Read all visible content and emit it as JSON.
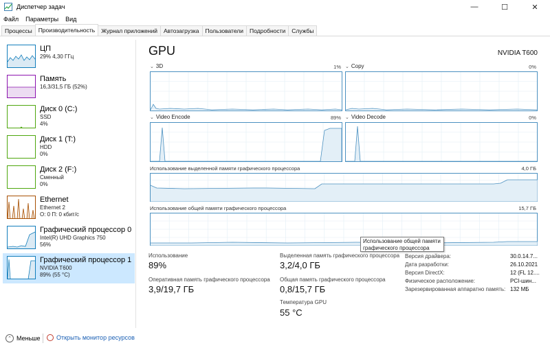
{
  "window": {
    "title": "Диспетчер задач",
    "minimize": "—",
    "maximize": "☐",
    "close": "✕"
  },
  "menu": [
    "Файл",
    "Параметры",
    "Вид"
  ],
  "tabs": [
    "Процессы",
    "Производительность",
    "Журнал приложений",
    "Автозагрузка",
    "Пользователи",
    "Подробности",
    "Службы"
  ],
  "active_tab": "Производительность",
  "sidebar": {
    "items": [
      {
        "name": "ЦП",
        "line1": "29% 4,30 ГГц",
        "line2": "",
        "color": "#117dbb"
      },
      {
        "name": "Память",
        "line1": "16,3/31,5 ГБ (52%)",
        "line2": "",
        "color": "#8b12ae"
      },
      {
        "name": "Диск 0 (C:)",
        "line1": "SSD",
        "line2": "4%",
        "color": "#4da60c"
      },
      {
        "name": "Диск 1 (T:)",
        "line1": "HDD",
        "line2": "0%",
        "color": "#4da60c"
      },
      {
        "name": "Диск 2 (F:)",
        "line1": "Сменный",
        "line2": "0%",
        "color": "#4da60c"
      },
      {
        "name": "Ethernet",
        "line1": "Ethernet 2",
        "line2": "О: 0 П: 0 кбит/с",
        "color": "#a74f01"
      },
      {
        "name": "Графический процессор 0",
        "line1": "Intel(R) UHD Graphics 750",
        "line2": "56%",
        "color": "#117dbb"
      },
      {
        "name": "Графический процессор 1",
        "line1": "NVIDIA T600",
        "line2": "89% (55 °C)",
        "color": "#117dbb"
      }
    ]
  },
  "main": {
    "title": "GPU",
    "model": "NVIDIA T600",
    "engines": [
      {
        "label": "3D",
        "percent": "1%"
      },
      {
        "label": "Copy",
        "percent": "0%"
      },
      {
        "label": "Video Encode",
        "percent": "89%"
      },
      {
        "label": "Video Decode",
        "percent": "0%"
      }
    ],
    "dedicated_memory": {
      "label": "Использование выделенной памяти графического процессора",
      "max": "4,0 ГБ"
    },
    "shared_memory": {
      "label": "Использование общей памяти графического процессора",
      "max": "15,7 ГБ"
    },
    "tooltip": "Использование общей памяти графического процессора",
    "stats": {
      "utilization_label": "Использование",
      "utilization_value": "89%",
      "gpu_mem_label": "Оперативная память графического процессора",
      "gpu_mem_value": "3,9/19,7 ГБ",
      "dedicated_label": "Выделенная память графического процессора",
      "dedicated_value": "3,2/4,0 ГБ",
      "shared_label": "Общая память графического процессора",
      "shared_value": "0,8/15,7 ГБ",
      "temp_label": "Температура GPU",
      "temp_value": "55 °C"
    },
    "info": [
      {
        "key": "Версия драйвера:",
        "value": "30.0.14.7..."
      },
      {
        "key": "Дата разработки:",
        "value": "26.10.2021"
      },
      {
        "key": "Версия DirectX:",
        "value": "12 (FL 12...."
      },
      {
        "key": "Физическое расположение:",
        "value": "PCI-шин..."
      },
      {
        "key": "Зарезервированная аппаратно память:",
        "value": "132 МБ"
      }
    ]
  },
  "footer": {
    "less": "Меньше",
    "monitor": "Открыть монитор ресурсов"
  },
  "colors": {
    "accent": "#117dbb",
    "selected": "#cce8ff"
  }
}
